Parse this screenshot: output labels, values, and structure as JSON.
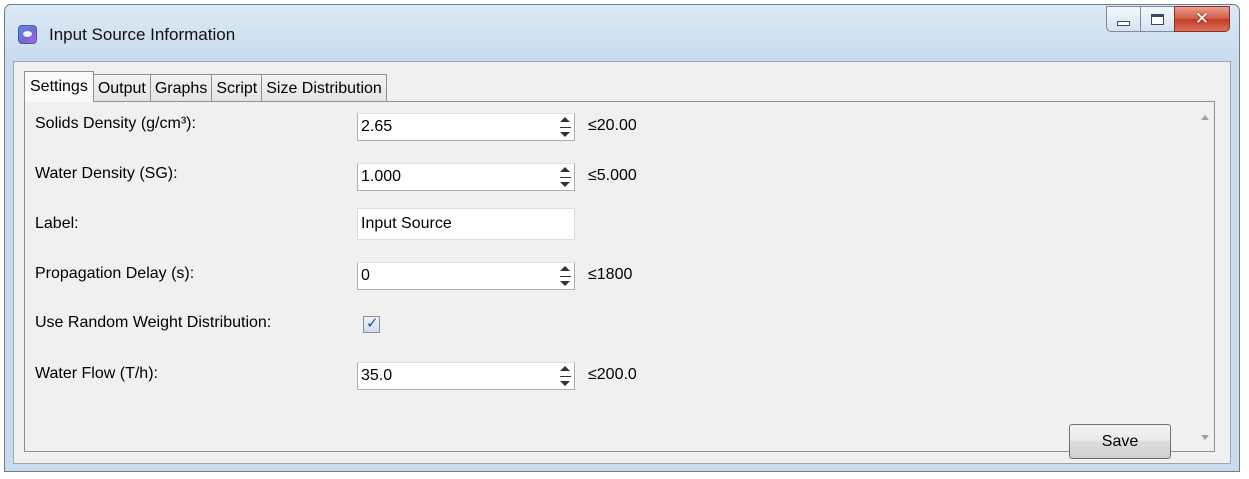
{
  "window": {
    "title": "Input Source Information",
    "controls": {
      "minimize": "minimize-icon",
      "maximize": "maximize-icon",
      "close": "close-icon"
    }
  },
  "tabs": [
    {
      "label": "Settings",
      "active": true
    },
    {
      "label": "Output",
      "active": false
    },
    {
      "label": "Graphs",
      "active": false
    },
    {
      "label": "Script",
      "active": false
    },
    {
      "label": "Size Distribution",
      "active": false
    }
  ],
  "settings": {
    "solids_density": {
      "label": "Solids Density (g/cm³):",
      "value": "2.65",
      "max": "≤20.00"
    },
    "water_density": {
      "label": "Water Density (SG):",
      "value": "1.000",
      "max": "≤5.000"
    },
    "label_field": {
      "label": "Label:",
      "value": "Input Source"
    },
    "propagation_delay": {
      "label": "Propagation Delay (s):",
      "value": "0",
      "max": "≤1800"
    },
    "random_weight": {
      "label": "Use Random Weight Distribution:",
      "checked": true
    },
    "water_flow": {
      "label": "Water Flow (T/h):",
      "value": "35.0",
      "max": "≤200.0"
    }
  },
  "save_label": "Save",
  "colors": {
    "titlebar": "#cfdff0",
    "close_button": "#c13c24",
    "panel": "#f0f0f0"
  }
}
